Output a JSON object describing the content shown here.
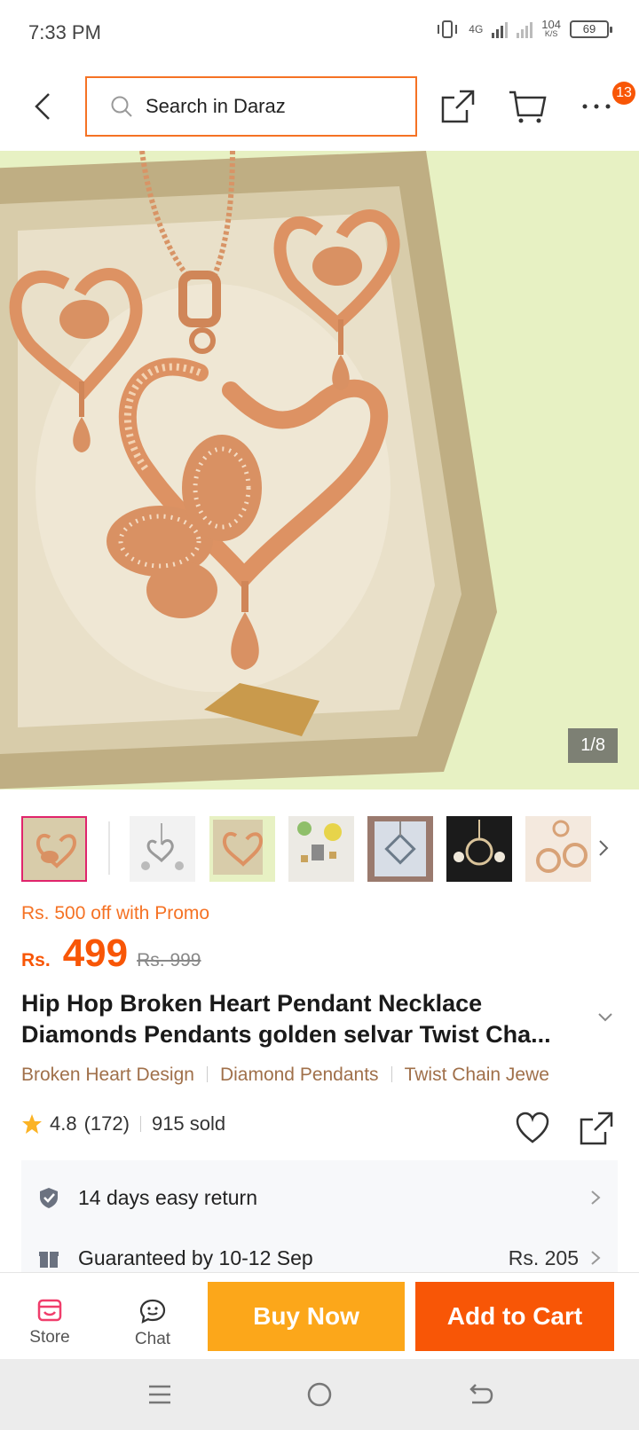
{
  "status_bar": {
    "time": "7:33 PM",
    "network": "4G",
    "speed_value": "104",
    "speed_unit": "K/S",
    "battery": "69"
  },
  "header": {
    "search_placeholder": "Search in Daraz",
    "icons": [
      "back-icon",
      "search-icon",
      "share-icon",
      "cart-icon",
      "more-icon"
    ],
    "more_badge": "13"
  },
  "gallery": {
    "counter": "1/8",
    "thumbnails": 7
  },
  "product": {
    "promo": "Rs. 500 off with Promo",
    "currency": "Rs.",
    "price": "499",
    "old_price": "Rs. 999",
    "title_line1": "Hip Hop Broken Heart Pendant Necklace",
    "title_line2": "Diamonds Pendants golden selvar Twist Cha...",
    "tags": [
      "Broken Heart Design",
      "Diamond Pendants",
      "Twist Chain Jewe"
    ],
    "rating": "4.8",
    "reviews": "(172)",
    "sold": "915 sold"
  },
  "services": [
    {
      "label": "14 days easy return",
      "icon": "shield-check-icon"
    },
    {
      "label": "Guaranteed by 10-12 Sep",
      "fee": "Rs. 205",
      "icon": "gift-icon"
    }
  ],
  "bottom_bar": {
    "store": "Store",
    "chat": "Chat",
    "buy_now": "Buy Now",
    "add_to_cart": "Add to Cart"
  },
  "colors": {
    "accent": "#f85606",
    "search_border": "#f57224",
    "buy_now": "#fca71a",
    "tags": "#a0704a",
    "active_thumb": "#e0246c"
  }
}
